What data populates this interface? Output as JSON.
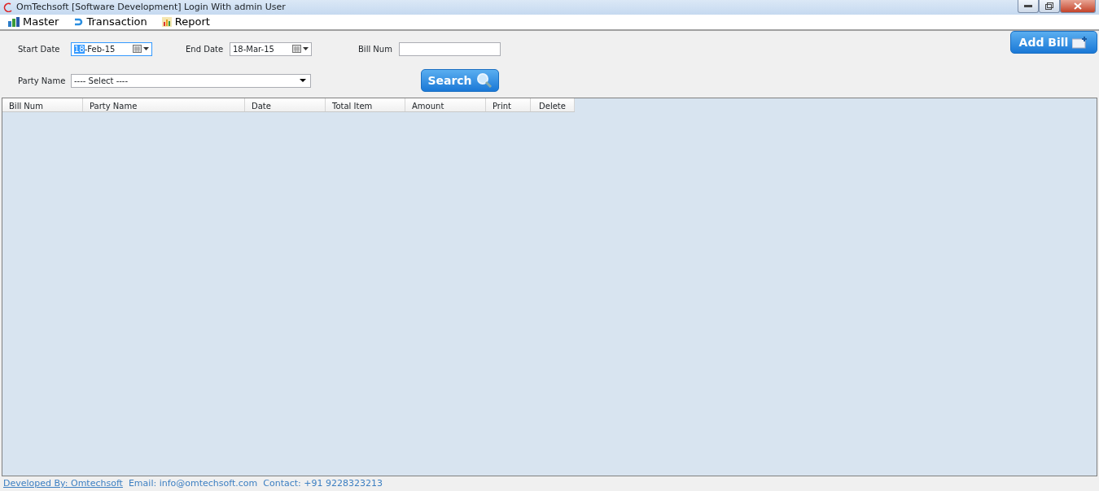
{
  "window": {
    "title": "OmTechsoft [Software Development] Login With admin User"
  },
  "menu": [
    {
      "label": "Master"
    },
    {
      "label": "Transaction"
    },
    {
      "label": "Report"
    }
  ],
  "filters": {
    "start_date": {
      "label": "Start Date",
      "value": "18-Feb-15",
      "focused": true
    },
    "end_date": {
      "label": "End Date",
      "value": "18-Mar-15",
      "focused": false
    },
    "bill_num": {
      "label": "Bill Num"
    },
    "party_name": {
      "label": "Party Name",
      "value": "---- Select ----"
    },
    "search_button": "Search",
    "add_button": "Add Bill"
  },
  "table": {
    "columns": [
      "Bill Num",
      "Party Name",
      "Date",
      "Total Item",
      "Amount",
      "Print",
      "Delete"
    ]
  },
  "status_bar": {
    "developer_link": "Developed By: Omtechsoft",
    "email": "Email: info@omtechsoft.com",
    "contact": "Contact: +91 9228323213"
  }
}
